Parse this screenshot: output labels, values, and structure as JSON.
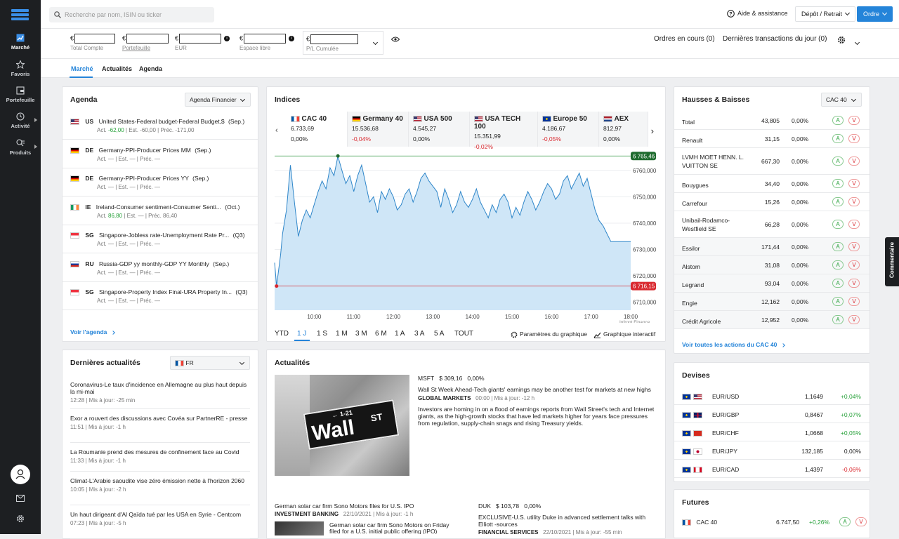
{
  "sidebar": {
    "items": [
      {
        "label": "Marché",
        "icon": "chart-icon"
      },
      {
        "label": "Favoris",
        "icon": "star-icon"
      },
      {
        "label": "Portefeuille",
        "icon": "wallet-icon"
      },
      {
        "label": "Activité",
        "icon": "clock-icon"
      },
      {
        "label": "Produits",
        "icon": "list-icon"
      }
    ]
  },
  "topbar": {
    "search_placeholder": "Recherche par nom, ISIN ou ticker",
    "help_label": "Aide & assistance",
    "deposit_label": "Dépôt / Retrait",
    "order_label": "Ordre"
  },
  "account": {
    "currency": "€",
    "fields": [
      "Total Compte",
      "Portefeuille",
      "EUR",
      "Espace libre",
      "P/L Cumulée"
    ],
    "orders": "Ordres en cours (0)",
    "transactions": "Dernières transactions du jour (0)"
  },
  "tabs": [
    "Marché",
    "Actualités",
    "Agenda"
  ],
  "agenda": {
    "title": "Agenda",
    "dropdown": "Agenda Financier",
    "link": "Voir l'agenda",
    "items": [
      {
        "cc": "US",
        "title": "United States-Federal budget-Federal Budget,$",
        "period": "(Sep.)",
        "act": "-62,00",
        "est": "-60,00",
        "prec": "-171,00",
        "actcolor": "green"
      },
      {
        "cc": "DE",
        "title": "Germany-PPI-Producer Prices MM",
        "period": "(Sep.)",
        "act": "—",
        "est": "—",
        "prec": "—",
        "actcolor": ""
      },
      {
        "cc": "DE",
        "title": "Germany-PPI-Producer Prices YY",
        "period": "(Sep.)",
        "act": "—",
        "est": "—",
        "prec": "—",
        "actcolor": ""
      },
      {
        "cc": "IE",
        "title": "Ireland-Consumer sentiment-Consumer Senti...",
        "period": "(Oct.)",
        "act": "86,80",
        "est": "—",
        "prec": "86,40",
        "actcolor": "green"
      },
      {
        "cc": "SG",
        "title": "Singapore-Jobless rate-Unemployment Rate Pr...",
        "period": "(Q3)",
        "act": "—",
        "est": "—",
        "prec": "—",
        "actcolor": ""
      },
      {
        "cc": "RU",
        "title": "Russia-GDP yy monthly-GDP YY Monthly",
        "period": "(Sep.)",
        "act": "—",
        "est": "—",
        "prec": "—",
        "actcolor": ""
      },
      {
        "cc": "SG",
        "title": "Singapore-Property Index Final-URA Property In...",
        "period": "(Q3)",
        "act": "—",
        "est": "—",
        "prec": "—",
        "actcolor": ""
      }
    ]
  },
  "labels": {
    "act": "Act.",
    "est": "Est.",
    "prec": "Préc.",
    "updated": "Mis à jour:"
  },
  "indices": {
    "title": "Indices",
    "tabs": [
      {
        "name": "CAC 40",
        "value": "6.733,69",
        "change": "0,00%",
        "cc": "FR",
        "color": ""
      },
      {
        "name": "Germany 40",
        "value": "15.536,68",
        "change": "-0,04%",
        "cc": "DE",
        "color": "red"
      },
      {
        "name": "USA 500",
        "value": "4.545,27",
        "change": "0,00%",
        "cc": "US",
        "color": ""
      },
      {
        "name": "USA TECH 100",
        "value": "15.351,99",
        "change": "-0,02%",
        "cc": "US",
        "color": "red"
      },
      {
        "name": "Europe 50",
        "value": "4.186,67",
        "change": "-0,05%",
        "cc": "EU",
        "color": "red"
      },
      {
        "name": "AEX",
        "value": "812,97",
        "change": "0,00%",
        "cc": "NL",
        "color": ""
      }
    ],
    "high_label": "6 765,46",
    "low_label": "6 716,15",
    "source": "Infront Finance",
    "periods": [
      "YTD",
      "1 J",
      "1 S",
      "1 M",
      "3 M",
      "6 M",
      "1 A",
      "3 A",
      "5 A",
      "TOUT"
    ],
    "settings_label": "Paramètres du graphique",
    "interactive_label": "Graphique interactif"
  },
  "chart_data": {
    "type": "area",
    "title": "",
    "x_ticks": [
      "10:00",
      "11:00",
      "12:00",
      "13:00",
      "14:00",
      "15:00",
      "16:00",
      "17:00",
      "18:00"
    ],
    "y_ticks": [
      6710000,
      6720000,
      6730000,
      6740000,
      6750000,
      6760000
    ],
    "y_tick_labels": [
      "6710,000",
      "6720,000",
      "6730,000",
      "6740,000",
      "6750,000",
      "6760,000"
    ],
    "ylim": [
      6707000,
      6765000
    ],
    "xlim": [
      9,
      18
    ],
    "high": 6765.46,
    "low": 6716.15,
    "x": [
      9.0,
      9.05,
      9.1,
      9.15,
      9.2,
      9.3,
      9.4,
      9.5,
      9.6,
      9.7,
      9.8,
      9.9,
      10.0,
      10.1,
      10.2,
      10.3,
      10.4,
      10.5,
      10.6,
      10.7,
      10.8,
      10.9,
      11.0,
      11.1,
      11.2,
      11.3,
      11.4,
      11.5,
      11.6,
      11.7,
      11.8,
      11.9,
      12.0,
      12.1,
      12.2,
      12.3,
      12.4,
      12.5,
      12.6,
      12.7,
      12.8,
      12.9,
      13.0,
      13.1,
      13.2,
      13.3,
      13.4,
      13.5,
      13.6,
      13.7,
      13.8,
      13.9,
      14.0,
      14.1,
      14.2,
      14.3,
      14.4,
      14.5,
      14.6,
      14.7,
      14.8,
      14.9,
      15.0,
      15.1,
      15.2,
      15.3,
      15.4,
      15.5,
      15.6,
      15.7,
      15.8,
      15.9,
      16.0,
      16.1,
      16.2,
      16.3,
      16.4,
      16.5,
      16.6,
      16.7,
      16.8,
      16.9,
      17.0,
      17.1,
      17.2,
      17.3,
      17.4,
      17.5,
      17.6,
      17.7,
      17.8,
      17.9,
      18.0
    ],
    "y": [
      6725,
      6716.2,
      6722,
      6728,
      6736,
      6745,
      6762,
      6748,
      6735,
      6741,
      6745,
      6742,
      6747,
      6752,
      6756,
      6753,
      6761,
      6758,
      6765.4,
      6760,
      6755,
      6758,
      6752,
      6758,
      6762,
      6755,
      6748,
      6750,
      6744,
      6752,
      6749,
      6753,
      6750,
      6745,
      6747,
      6751,
      6753,
      6748,
      6752,
      6757,
      6759,
      6756,
      6754,
      6752,
      6746,
      6753,
      6749,
      6744,
      6747,
      6752,
      6748,
      6746,
      6749,
      6753,
      6748,
      6745,
      6742,
      6747,
      6744,
      6749,
      6751,
      6748,
      6742,
      6746,
      6743,
      6748,
      6752,
      6749,
      6745,
      6748,
      6752,
      6755,
      6753,
      6749,
      6751,
      6756,
      6758,
      6753,
      6756,
      6759,
      6754,
      6757,
      6751,
      6745,
      6741,
      6739,
      6736,
      6733,
      6733,
      6733,
      6733,
      6733,
      6733
    ]
  },
  "movers": {
    "title": "Hausses & Baisses",
    "dropdown": "CAC 40",
    "link": "Voir toutes les actions du CAC 40",
    "rows": [
      {
        "name": "Total",
        "price": "43,805",
        "change": "0,00%"
      },
      {
        "name": "Renault",
        "price": "31,15",
        "change": "0,00%"
      },
      {
        "name": "LVMH MOET HENN. L. VUITTON SE",
        "price": "667,30",
        "change": "0,00%"
      },
      {
        "name": "Bouygues",
        "price": "34,40",
        "change": "0,00%"
      },
      {
        "name": "Carrefour",
        "price": "15,26",
        "change": "0,00%"
      },
      {
        "name": "Unibail-Rodamco-Westfield SE",
        "price": "66,28",
        "change": "0,00%"
      },
      {
        "name": "Essilor",
        "price": "171,44",
        "change": "0,00%"
      },
      {
        "name": "Alstom",
        "price": "31,08",
        "change": "0,00%"
      },
      {
        "name": "Legrand",
        "price": "93,04",
        "change": "0,00%"
      },
      {
        "name": "Engie",
        "price": "12,162",
        "change": "0,00%"
      },
      {
        "name": "Crédit Agricole",
        "price": "12,952",
        "change": "0,00%"
      }
    ],
    "a": "A",
    "v": "V"
  },
  "side_tab": "Commentaire",
  "news_left": {
    "title": "Dernières actualités",
    "lang": "FR",
    "items": [
      {
        "title": "Coronavirus-Le taux d'incidence en Allemagne au plus haut depuis la mi-mai",
        "time": "12:28",
        "upd": "-25 min"
      },
      {
        "title": "Exor a rouvert des discussions avec Covéa sur PartnerRE - presse",
        "time": "11:51",
        "upd": "-1 h"
      },
      {
        "title": "La Roumanie prend des mesures de confinement face au Covid",
        "time": "11:33",
        "upd": "-1 h"
      },
      {
        "title": "Climat-L'Arabie saoudite vise zéro émission nette à l'horizon 2060",
        "time": "10:05",
        "upd": "-2 h"
      },
      {
        "title": "Un haut dirigeant d'Al Qaïda tué par les USA en Syrie - Centcom",
        "time": "07:23",
        "upd": "-5 h"
      }
    ]
  },
  "news_main": {
    "title": "Actualités",
    "image": {
      "sign_text": "Wall",
      "arrow": "← 1-21",
      "st": "ST"
    },
    "feature": {
      "ticker": "MSFT",
      "price": "$ 309,16",
      "change": "0,00%",
      "headline": "Wall St Week Ahead-Tech giants' earnings may be another test for markets at new highs",
      "source": "GLOBAL MARKETS",
      "time": "00:00",
      "upd": "-12 h",
      "body": "Investors are homing in on a flood of earnings reports from Wall Street's tech and Internet giants, as the high-growth stocks that have led markets higher for years face pressures from regulation, supply-chain snags and rising Treasury yields."
    },
    "item2": {
      "headline": "German solar car firm Sono Motors files for U.S. IPO",
      "source": "INVESTMENT BANKING",
      "date": "22/10/2021",
      "upd": "-1 h",
      "body": "German solar car firm Sono Motors on Friday filed for a U.S. initial public offering (IPO)"
    },
    "item3": {
      "ticker": "DUK",
      "price": "$ 103,78",
      "change": "0,00%",
      "headline": "EXCLUSIVE-U.S. utility Duke in advanced settlement talks with Elliott -sources",
      "source": "FINANCIAL SERVICES",
      "date": "22/10/2021",
      "upd": "-55 min"
    }
  },
  "currencies": {
    "title": "Devises",
    "rows": [
      {
        "pair": "EUR/USD",
        "value": "1,1649",
        "change": "+0,04%",
        "cc": "US",
        "color": "green"
      },
      {
        "pair": "EUR/GBP",
        "value": "0,8467",
        "change": "+0,07%",
        "cc": "GB",
        "color": "green"
      },
      {
        "pair": "EUR/CHF",
        "value": "1,0668",
        "change": "+0,05%",
        "cc": "CH",
        "color": "green"
      },
      {
        "pair": "EUR/JPY",
        "value": "132,185",
        "change": "0,00%",
        "cc": "JP",
        "color": ""
      },
      {
        "pair": "EUR/CAD",
        "value": "1,4397",
        "change": "-0,06%",
        "cc": "CA",
        "color": "red"
      }
    ]
  },
  "futures": {
    "title": "Futures",
    "rows": [
      {
        "name": "CAC 40",
        "value": "6.747,50",
        "change": "+0,26%"
      }
    ]
  },
  "colors": {
    "accent": "#2484d9",
    "green": "#27a13a",
    "red": "#d9292f",
    "chart_fill": "#cfe6f7",
    "chart_line": "#2f86c9"
  }
}
